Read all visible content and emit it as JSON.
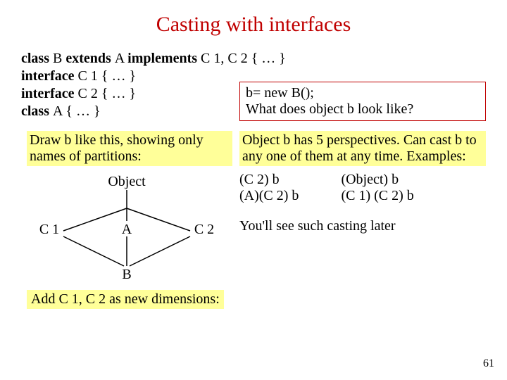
{
  "title": "Casting with interfaces",
  "decl": {
    "l1a": "class ",
    "l1b": "B ",
    "l1c": "extends ",
    "l1d": "A ",
    "l1e": "implements ",
    "l1f": "C 1, C 2 { … }",
    "l2a": "interface ",
    "l2b": "C 1 { … }",
    "l3a": "interface ",
    "l3b": "C 2 { … }",
    "l4a": "class ",
    "l4b": "A { … }"
  },
  "box1": {
    "l1": "b= new B();",
    "l2": "What does object b look like?"
  },
  "draw": "Draw b like this, showing only names of partitions:",
  "persp": "Object b has 5 perspectives. Can cast b to any one of them at any time. Examples:",
  "diagram": {
    "object": "Object",
    "a": "A",
    "b": "B",
    "c1": "C 1",
    "c2": "C 2"
  },
  "casts": {
    "c1": "(C 2) b",
    "c2": "(A)(C 2) b",
    "c3": "(Object) b",
    "c4": "(C 1) (C 2) b"
  },
  "later": "You'll see such casting later",
  "add": "Add C 1, C 2 as new dimensions:",
  "page": "61"
}
